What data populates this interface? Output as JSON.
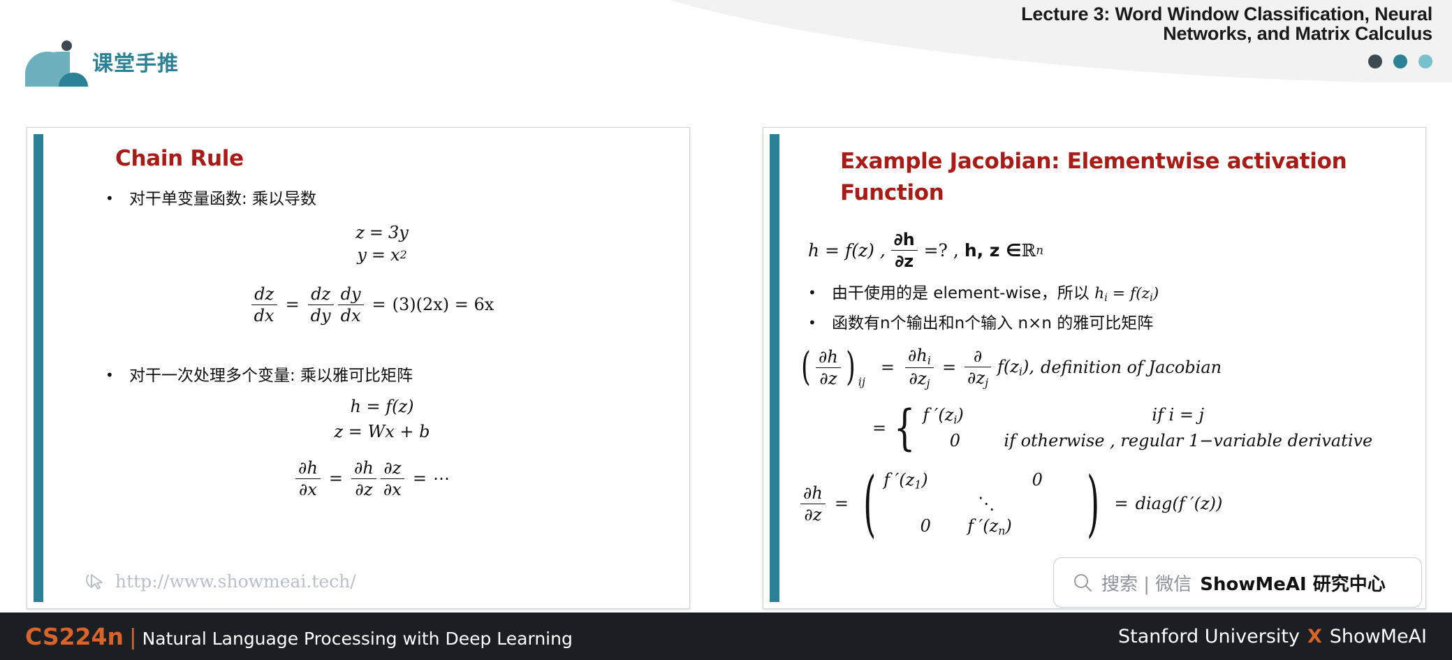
{
  "header": {
    "lecture_title_line1": "Lecture 3:  Word Window Classification, Neural",
    "lecture_title_line2": "Networks, and Matrix Calculus",
    "logo_text": "课堂手推"
  },
  "left_panel": {
    "title": "Chain Rule",
    "bullet1": "对干单变量函数: 乘以导数",
    "eq_z": {
      "lhs": "z",
      "eq": "=",
      "rhs": "3y"
    },
    "eq_y": {
      "lhs": "y",
      "eq": "=",
      "rhs": "x",
      "exp": "2"
    },
    "chain_eq": {
      "f1_num": "dz",
      "f1_den": "dx",
      "eq1": "=",
      "f2_num": "dz",
      "f2_den": "dy",
      "f3_num": "dy",
      "f3_den": "dx",
      "eq2": "=",
      "result": "(3)(2x) = 6x"
    },
    "bullet2": "对干一次处理多个变量: 乘以雅可比矩阵",
    "eq_h": "h = f(z)",
    "eq_wx": "z = Wx + b",
    "partial_eq": {
      "f1_num": "∂h",
      "f1_den": "∂x",
      "eq1": "=",
      "f2_num": "∂h",
      "f2_den": "∂z",
      "f3_num": "∂z",
      "f3_den": "∂x",
      "eq2": "=",
      "tail": "⋯"
    },
    "watermark_url": "http://www.showmeai.tech/"
  },
  "right_panel": {
    "title_line1": "Example Jacobian:  Elementwise activation",
    "title_line2": "Function",
    "eq_top": {
      "p1": "h = f(z) ,",
      "frac_num": "∂h",
      "frac_den": "∂z",
      "p2": "=? ,",
      "p3": "h, z ∈ ",
      "p4": "ℝ",
      "p4_sup": "n"
    },
    "bullet1_pre": "由干使用的是 element-wise，所以 ",
    "bullet1_math": "h",
    "bullet1_sub": "i",
    "bullet1_post": " = f(z",
    "bullet1_sub2": "i",
    "bullet1_end": ")",
    "bullet2": "函数有n个输出和n个输入 n×n 的雅可比矩阵",
    "jacobian_def": {
      "lhs_num": "∂h",
      "lhs_den": "∂z",
      "lhs_sub": "ij",
      "eq1": "=",
      "m1_num": "∂h",
      "m1_num_sub": "i",
      "m1_den": "∂z",
      "m1_den_sub": "j",
      "eq2": "=",
      "m2_num": "∂",
      "m2_den": "∂z",
      "m2_den_sub": "j",
      "fz": "f(z",
      "fz_sub": "i",
      "fz_end": "),",
      "note": "definition of Jacobian"
    },
    "cases": {
      "eq": "=",
      "case1_val": "f ′(z",
      "case1_sub": "i",
      "case1_end": ")",
      "case1_cond": "if i = j",
      "case2_val": "0",
      "case2_cond": "if otherwise , regular 1−variable derivative"
    },
    "diag_eq": {
      "lhs_num": "∂h",
      "lhs_den": "∂z",
      "eq1": "=",
      "m_tl": "f ′(z",
      "m_tl_sub": "1",
      "m_tl_end": ")",
      "m_tr": "0",
      "m_mid": "⋱",
      "m_bl": "0",
      "m_br": "f ′(z",
      "m_br_sub": "n",
      "m_br_end": ")",
      "eq2": "=",
      "rhs": "diag(f ′(z))"
    },
    "search": {
      "placeholder": "搜索 | 微信",
      "brand": "ShowMeAI 研究中心"
    }
  },
  "footer": {
    "course_code": "CS224n",
    "separator": "|",
    "course_name": "Natural Language Processing with Deep Learning",
    "right_pre": "Stanford University",
    "right_x": "X",
    "right_post": "ShowMeAI"
  },
  "colors": {
    "accent_teal": "#2b8296",
    "title_red": "#a81b16",
    "orange": "#d9642a",
    "footer_bg": "#1b1f24"
  }
}
